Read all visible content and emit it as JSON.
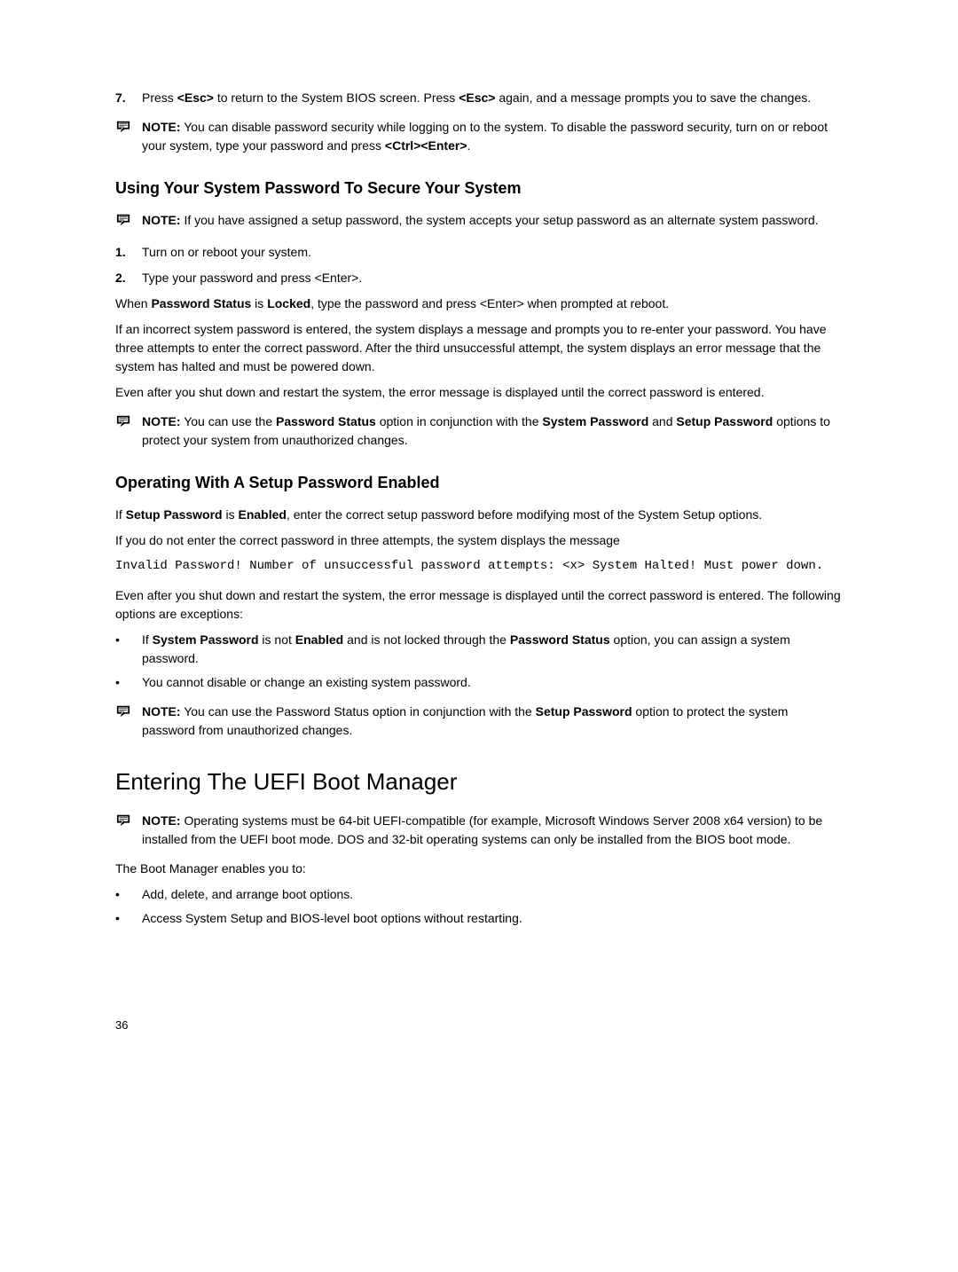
{
  "step7": {
    "num": "7.",
    "prefix": "Press ",
    "key1": "<Esc>",
    "mid": " to return to the System BIOS screen. Press ",
    "key2": "<Esc>",
    "suffix": " again, and a message prompts you to save the changes."
  },
  "note1": {
    "label": "NOTE:",
    "text": " You can disable password security while logging on to the system. To disable the password security, turn on or reboot your system, type your password and press ",
    "key": "<Ctrl><Enter>",
    "suffix": "."
  },
  "heading1": "Using Your System Password To Secure Your System",
  "note2": {
    "label": "NOTE:",
    "text": " If you have assigned a setup password, the system accepts your setup password as an alternate system password."
  },
  "step1": {
    "num": "1.",
    "text": "Turn on or reboot your system."
  },
  "step2": {
    "num": "2.",
    "text": "Type your password and press <Enter>."
  },
  "para1": {
    "p1": "When ",
    "b1": "Password Status",
    "p2": " is ",
    "b2": "Locked",
    "p3": ", type the password and press <Enter> when prompted at reboot."
  },
  "para2": "If an incorrect system password is entered, the system displays a message and prompts you to re-enter your password. You have three attempts to enter the correct password. After the third unsuccessful attempt, the system displays an error message that the system has halted and must be powered down.",
  "para3": "Even after you shut down and restart the system, the error message is displayed until the correct password is entered.",
  "note3": {
    "label": "NOTE:",
    "p1": " You can use the ",
    "b1": "Password Status",
    "p2": " option in conjunction with the ",
    "b2": "System Password",
    "p3": " and ",
    "b3": "Setup Password",
    "p4": " options to protect your system from unauthorized changes."
  },
  "heading2": "Operating With A Setup Password Enabled",
  "para4": {
    "p1": "If ",
    "b1": "Setup Password",
    "p2": " is ",
    "b2": "Enabled",
    "p3": ", enter the correct setup password before modifying most of the System Setup options."
  },
  "para5": "If you do not enter the correct password in three attempts, the system displays the message",
  "code1": "Invalid Password! Number of unsuccessful password attempts: <x> System Halted! Must power down.",
  "para6": "Even after you shut down and restart the system, the error message is displayed until the correct password is entered. The following options are exceptions:",
  "bullet1": {
    "p1": "If ",
    "b1": "System Password",
    "p2": " is not ",
    "b2": "Enabled",
    "p3": " and is not locked through the ",
    "b3": "Password Status",
    "p4": " option, you can assign a system password."
  },
  "bullet2": "You cannot disable or change an existing system password.",
  "note4": {
    "label": "NOTE:",
    "p1": " You can use the Password Status option in conjunction with the ",
    "b1": "Setup Password",
    "p2": " option to protect the system password from unauthorized changes."
  },
  "heading3": "Entering The UEFI Boot Manager",
  "note5": {
    "label": "NOTE:",
    "text": " Operating systems must be 64-bit UEFI-compatible (for example, Microsoft Windows Server 2008 x64 version) to be installed from the UEFI boot mode. DOS and 32-bit operating systems can only be installed from the BIOS boot mode."
  },
  "para7": "The Boot Manager enables you to:",
  "bullet3": "Add, delete, and arrange boot options.",
  "bullet4": "Access System Setup and BIOS-level boot options without restarting.",
  "pagenum": "36",
  "bulletchar": "•"
}
